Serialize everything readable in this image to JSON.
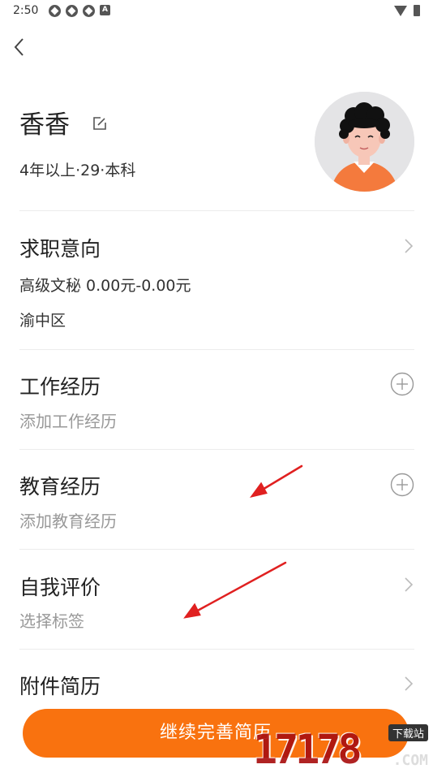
{
  "status_bar": {
    "time": "2:50"
  },
  "profile": {
    "name": "香香",
    "meta": "4年以上·29·本科"
  },
  "sections": {
    "intent": {
      "title": "求职意向",
      "position_salary": "高级文秘  0.00元-0.00元",
      "district": "渝中区"
    },
    "work": {
      "title": "工作经历",
      "subtitle": "添加工作经历"
    },
    "education": {
      "title": "教育经历",
      "subtitle": "添加教育经历"
    },
    "self_eval": {
      "title": "自我评价",
      "subtitle": "选择标签"
    },
    "attachment": {
      "title": "附件简历"
    }
  },
  "cta": {
    "label": "继续完善简历"
  },
  "watermark": {
    "logo_text": "17178",
    "site_label": "下载站",
    "domain": ".COM"
  },
  "colors": {
    "accent": "#f9720f",
    "annotation_arrow": "#e02020"
  },
  "icons": [
    "back-icon",
    "edit-icon",
    "chevron-right-icon",
    "plus-circle-icon",
    "avatar-illustration"
  ]
}
